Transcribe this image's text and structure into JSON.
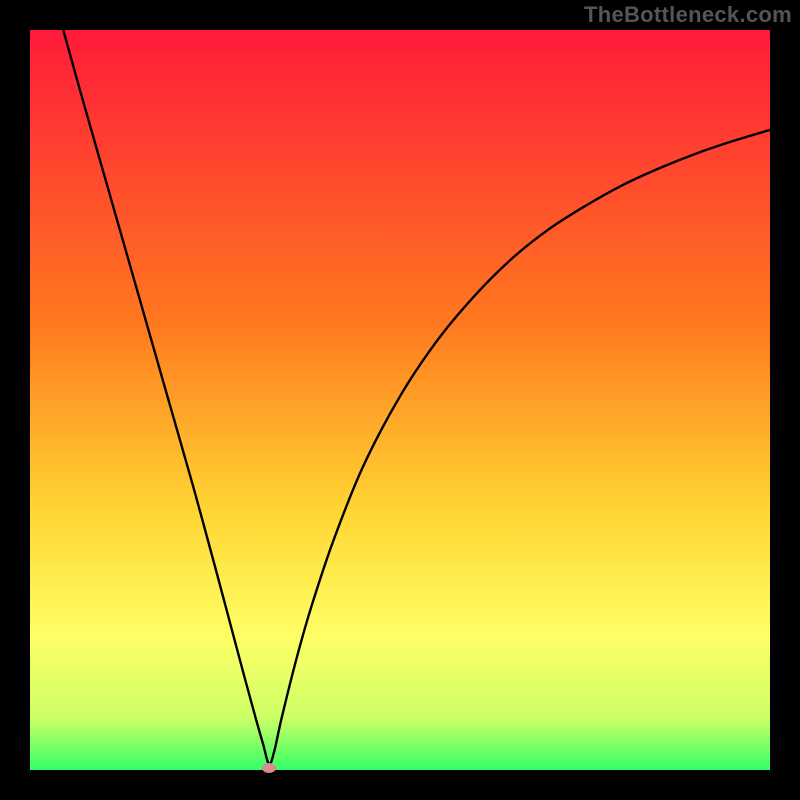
{
  "watermark": "TheBottleneck.com",
  "colors": {
    "background": "#000000",
    "curve_stroke": "#000000",
    "marker_fill": "#d88c8c",
    "gradient_top": "#ff1a3a",
    "gradient_mid1": "#ff7a1f",
    "gradient_mid2": "#ffd633",
    "gradient_mid3": "#ffff66",
    "gradient_mid4": "#ccff66",
    "gradient_bottom": "#33ff66"
  },
  "chart_data": {
    "type": "line",
    "title": "",
    "xlabel": "",
    "ylabel": "",
    "xlim": [
      0,
      100
    ],
    "ylim": [
      0,
      100
    ],
    "grid": false,
    "series": [
      {
        "name": "curve",
        "x": [
          4.5,
          7,
          10,
          13,
          16,
          19,
          22,
          25,
          27,
          29,
          30.5,
          31.5,
          32.3,
          33,
          34,
          36,
          38,
          41,
          45,
          50,
          55,
          60,
          65,
          70,
          75,
          80,
          85,
          90,
          95,
          100
        ],
        "y": [
          100,
          91,
          80.5,
          70,
          59.5,
          49,
          38.5,
          27.5,
          20,
          12.5,
          7,
          3.5,
          0.8,
          2.5,
          7,
          15,
          22,
          31,
          41,
          50.5,
          58,
          64,
          69,
          73,
          76.2,
          79,
          81.3,
          83.3,
          85,
          86.5
        ]
      }
    ],
    "marker": {
      "x": 32.3,
      "y": 0.3
    }
  }
}
